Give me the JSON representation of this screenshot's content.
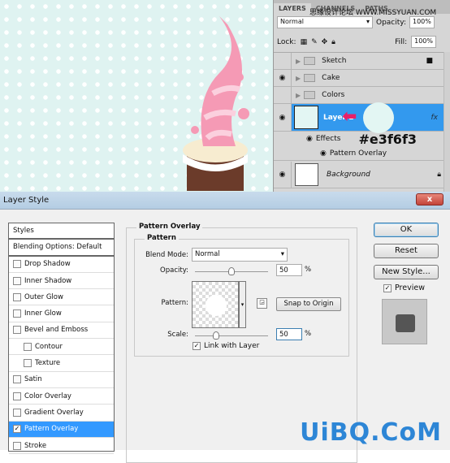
{
  "layers_panel": {
    "tabs": [
      "LAYERS",
      "CHANNELS",
      "PATHS"
    ],
    "watermark": "思缘设计论坛 WWW.MISSYUAN.COM",
    "blend_mode": "Normal",
    "opacity_label": "Opacity:",
    "opacity": "100%",
    "lock_label": "Lock:",
    "fill_label": "Fill:",
    "fill": "100%",
    "layers": [
      {
        "name": "Sketch",
        "visible": false,
        "type": "group",
        "locked": true
      },
      {
        "name": "Cake",
        "visible": true,
        "type": "group"
      },
      {
        "name": "Colors",
        "visible": false,
        "type": "group"
      },
      {
        "name": "Layer 1",
        "visible": true,
        "selected": true,
        "fx": "fx"
      },
      {
        "name": "Background",
        "visible": true,
        "locked": true
      }
    ],
    "effects_label": "Effects",
    "effect_item": "Pattern Overlay",
    "color_annotation": "#e3f6f3"
  },
  "dialog": {
    "title": "Layer Style",
    "close": "x",
    "styles": [
      {
        "label": "Styles",
        "head": true
      },
      {
        "label": "Blending Options: Default",
        "head": true
      },
      {
        "label": "Drop Shadow",
        "checked": false
      },
      {
        "label": "Inner Shadow",
        "checked": false
      },
      {
        "label": "Outer Glow",
        "checked": false
      },
      {
        "label": "Inner Glow",
        "checked": false
      },
      {
        "label": "Bevel and Emboss",
        "checked": false
      },
      {
        "label": "Contour",
        "checked": false,
        "indent": true
      },
      {
        "label": "Texture",
        "checked": false,
        "indent": true
      },
      {
        "label": "Satin",
        "checked": false
      },
      {
        "label": "Color Overlay",
        "checked": false
      },
      {
        "label": "Gradient Overlay",
        "checked": false
      },
      {
        "label": "Pattern Overlay",
        "checked": true,
        "selected": true
      },
      {
        "label": "Stroke",
        "checked": false
      }
    ],
    "section_title": "Pattern Overlay",
    "group_title": "Pattern",
    "blend_mode_label": "Blend Mode:",
    "blend_mode": "Normal",
    "opacity_label": "Opacity:",
    "opacity": "50",
    "percent": "%",
    "pattern_label": "Pattern:",
    "snap_button": "Snap to Origin",
    "scale_label": "Scale:",
    "scale": "50",
    "link_label": "Link with Layer",
    "link_checked": true,
    "opacity_value": 50,
    "scale_value": 50,
    "buttons": {
      "ok": "OK",
      "reset": "Reset",
      "new_style": "New Style..."
    },
    "preview_label": "Preview",
    "preview_checked": true
  },
  "watermark": "UiBQ.CoM",
  "colors": {
    "accent": "#3399ff",
    "canvas": "#e3f6f3",
    "arrow": "#e8206a",
    "watermark": "#2d86d6"
  }
}
